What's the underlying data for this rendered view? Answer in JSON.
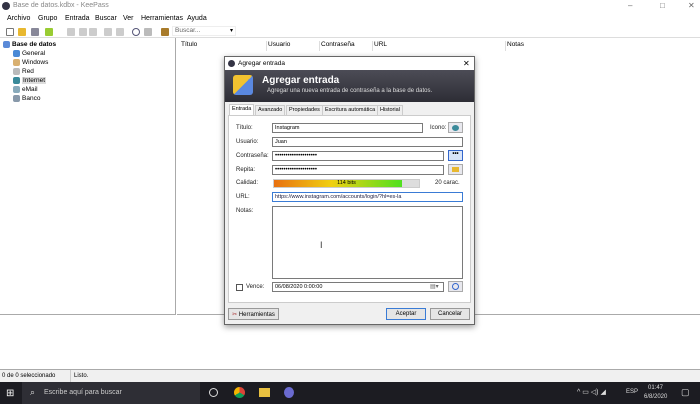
{
  "window": {
    "title": "Base de datos.kdbx - KeePass"
  },
  "menu": [
    "Archivo",
    "Grupo",
    "Entrada",
    "Buscar",
    "Ver",
    "Herramientas",
    "Ayuda"
  ],
  "toolbar": {
    "search_placeholder": "Buscar..."
  },
  "tree": {
    "root": "Base de datos",
    "items": [
      "General",
      "Windows",
      "Red",
      "Internet",
      "eMail",
      "Banco"
    ],
    "selected": "Internet"
  },
  "list": {
    "columns": [
      "Título",
      "Usuario",
      "Contraseña",
      "URL",
      "Notas"
    ]
  },
  "status": {
    "selection": "0 de 0 seleccionado",
    "state": "Listo."
  },
  "dialog": {
    "title": "Agregar entrada",
    "banner_title": "Agregar entrada",
    "banner_subtitle": "Agregar una nueva entrada de contraseña a la base de datos.",
    "tabs": [
      "Entrada",
      "Avanzado",
      "Propiedades",
      "Escritura automática",
      "Historial"
    ],
    "active_tab": "Entrada",
    "labels": {
      "title": "Título:",
      "icon": "Icono:",
      "user": "Usuario:",
      "password": "Contraseña:",
      "repeat": "Repita:",
      "quality": "Calidad:",
      "url": "URL:",
      "notes": "Notas:",
      "expires": "Vence:"
    },
    "values": {
      "title": "Instagram",
      "user": "Juan",
      "password": "••••••••••••••••••••",
      "repeat": "••••••••••••••••••••",
      "url": "https://www.instagram.com/accounts/login/?hl=es-la",
      "notes": "",
      "expires": "06/08/2020   0:00:00"
    },
    "quality": {
      "text": "114 bits",
      "fraction": 0.88,
      "chars": "20 carac."
    },
    "expires_checked": false,
    "buttons": {
      "tools": "Herramientas",
      "ok": "Aceptar",
      "cancel": "Cancelar",
      "show_password": "•••"
    }
  },
  "taskbar": {
    "search_placeholder": "Escribe aquí para buscar",
    "lang": "ESP",
    "time": "01:47",
    "date": "6/8/2020"
  }
}
